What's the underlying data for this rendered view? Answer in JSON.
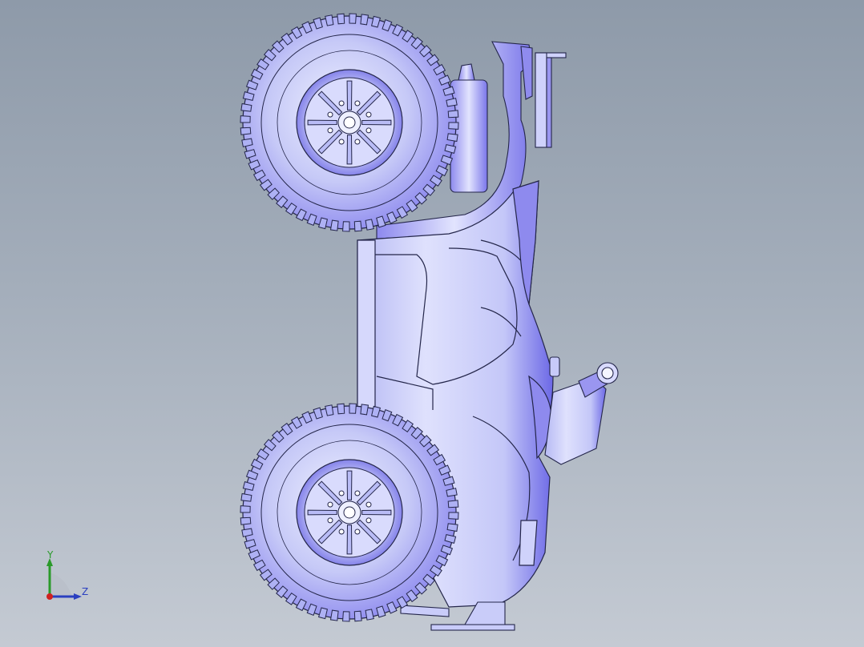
{
  "viewport": {
    "background_top": "#8e9aa9",
    "background_bottom": "#c4cad3",
    "model_color": "#c5c9f8",
    "model_shade": "#6a66e6",
    "edge_color": "#24264a"
  },
  "triad": {
    "y_label": "Y",
    "z_label": "Z",
    "y_color": "#2a9a2a",
    "z_color": "#2a3fc0",
    "x_color": "#d02020"
  }
}
